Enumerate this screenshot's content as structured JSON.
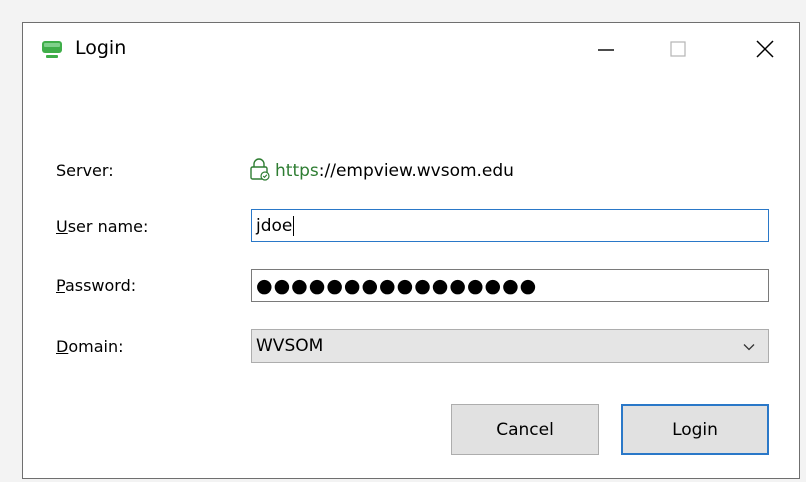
{
  "window": {
    "title": "Login"
  },
  "form": {
    "server_label": "Server:",
    "server_scheme": "https",
    "server_rest": "://empview.wvsom.edu",
    "username_label_key": "U",
    "username_label_rest": "ser name:",
    "username_value": "jdoe",
    "password_label_key": "P",
    "password_label_rest": "assword:",
    "password_masked": "●●●●●●●●●●●●●●●●",
    "domain_label_key": "D",
    "domain_label_rest": "omain:",
    "domain_selected": "WVSOM"
  },
  "buttons": {
    "cancel_label": "Cancel",
    "login_label": "Login"
  },
  "icons": {
    "app": "monitor-icon",
    "lock": "lock-icon",
    "minimize": "minimize-icon",
    "maximize": "maximize-icon",
    "close": "close-icon",
    "dropdown": "chevron-down-icon"
  },
  "colors": {
    "accent": "#2a78c8",
    "secure": "#2e7d32",
    "app_icon": "#3fae49"
  }
}
